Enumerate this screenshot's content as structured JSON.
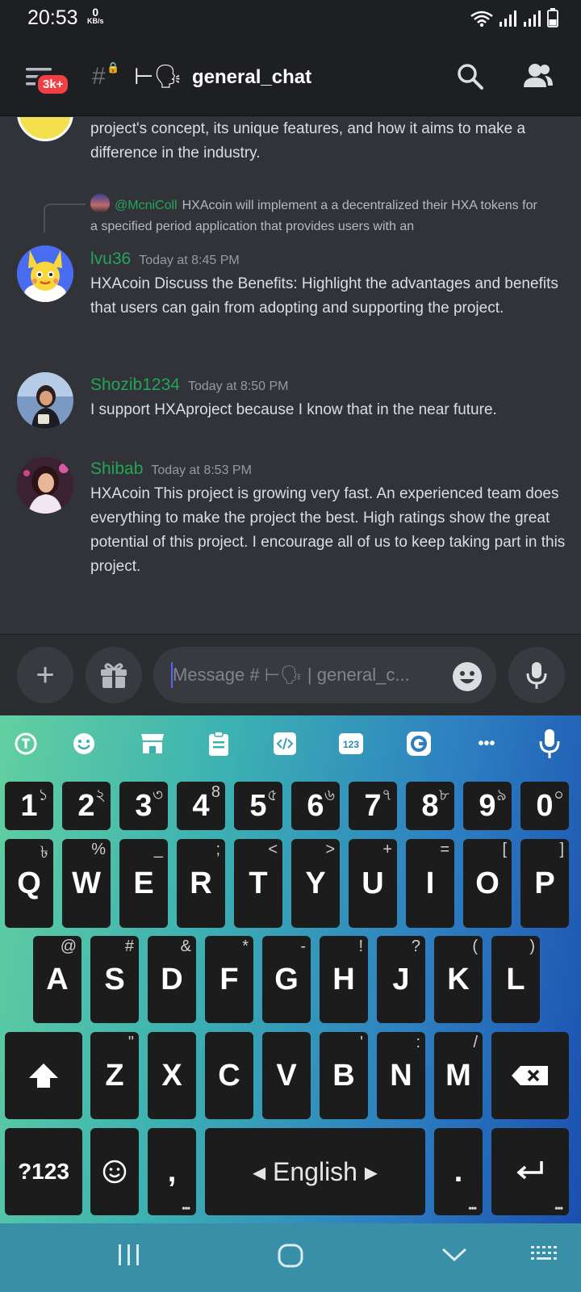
{
  "status_bar": {
    "time": "20:53",
    "net_speed": "0",
    "net_unit": "KB/s"
  },
  "header": {
    "badge": "3k+",
    "channel_prefix": "⊢🗣",
    "channel_name": "general_chat",
    "icons": [
      "hamburger-icon",
      "locked-channel-icon",
      "search-icon",
      "members-icon"
    ]
  },
  "messages": {
    "prev_text": "project's concept, its unique features, and how it aims to make a difference in the industry.",
    "reply": {
      "user": "@McniColl",
      "text": "HXAcoin will implement a a decentralized  their HXA tokens for a specified period application that provides users with an"
    },
    "items": [
      {
        "author": "lvu36",
        "time": "Today at 8:45 PM",
        "text": "HXAcoin Discuss the Benefits: Highlight the advantages and benefits that users can gain from adopting and supporting the project."
      },
      {
        "author": "Shozib1234",
        "time": "Today at 8:50 PM",
        "text": "I support HXAproject because I know that in the near future."
      },
      {
        "author": "Shibab",
        "time": "Today at 8:53 PM",
        "text": "HXAcoin This project is growing very fast. An experienced team does everything to make the project the best. High ratings show the great potential of this project. I encourage all of us to keep taking part in this project."
      }
    ]
  },
  "composer": {
    "placeholder": "Message # ⊢🗣 | general_c...",
    "add_label": "+"
  },
  "keyboard": {
    "toolbar_badge": "123",
    "more": "•••",
    "row_numbers": [
      {
        "main": "1",
        "sub": "১"
      },
      {
        "main": "2",
        "sub": "২"
      },
      {
        "main": "3",
        "sub": "৩"
      },
      {
        "main": "4",
        "sub": "8"
      },
      {
        "main": "5",
        "sub": "৫"
      },
      {
        "main": "6",
        "sub": "৬"
      },
      {
        "main": "7",
        "sub": "৭"
      },
      {
        "main": "8",
        "sub": "৮"
      },
      {
        "main": "9",
        "sub": "৯"
      },
      {
        "main": "0",
        "sub": "০"
      }
    ],
    "row_q": [
      {
        "main": "Q",
        "sub": "৳"
      },
      {
        "main": "W",
        "sub": "%"
      },
      {
        "main": "E",
        "sub": "_"
      },
      {
        "main": "R",
        "sub": ";"
      },
      {
        "main": "T",
        "sub": "<"
      },
      {
        "main": "Y",
        "sub": ">"
      },
      {
        "main": "U",
        "sub": "+"
      },
      {
        "main": "I",
        "sub": "="
      },
      {
        "main": "O",
        "sub": "["
      },
      {
        "main": "P",
        "sub": "]"
      }
    ],
    "row_a": [
      {
        "main": "A",
        "sub": "@"
      },
      {
        "main": "S",
        "sub": "#"
      },
      {
        "main": "D",
        "sub": "&"
      },
      {
        "main": "F",
        "sub": "*"
      },
      {
        "main": "G",
        "sub": "-"
      },
      {
        "main": "H",
        "sub": "!"
      },
      {
        "main": "J",
        "sub": "?"
      },
      {
        "main": "K",
        "sub": "("
      },
      {
        "main": "L",
        "sub": ")"
      }
    ],
    "row_z": [
      {
        "main": "Z",
        "sub": "\""
      },
      {
        "main": "X",
        "sub": ""
      },
      {
        "main": "C",
        "sub": ""
      },
      {
        "main": "V",
        "sub": ""
      },
      {
        "main": "B",
        "sub": "'"
      },
      {
        "main": "N",
        "sub": ":"
      },
      {
        "main": "M",
        "sub": "/"
      }
    ],
    "symbols_key": "?123",
    "comma_key": ",",
    "space_key": "◂ English ▸",
    "period_key": ".",
    "key_dots": "•••"
  },
  "colors": {
    "author_green": "#23a559",
    "badge_red": "#f23f43",
    "background": "#313338"
  }
}
